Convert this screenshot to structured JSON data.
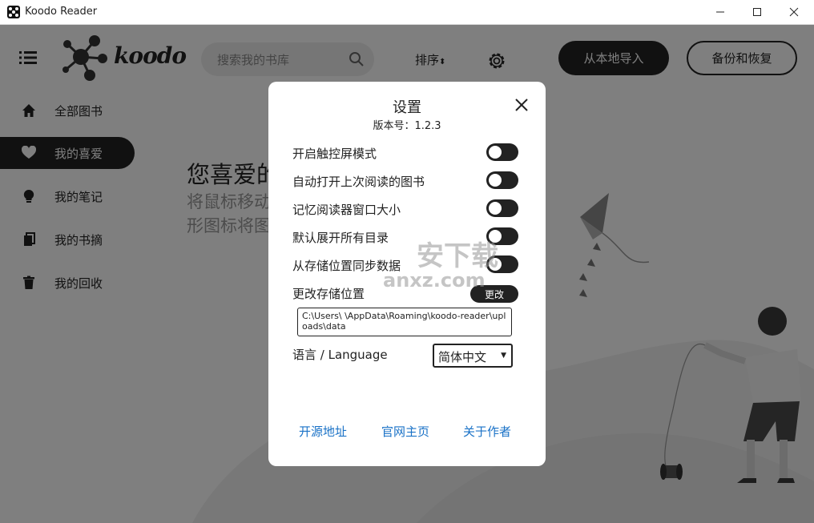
{
  "window": {
    "title": "Koodo Reader",
    "controls": [
      "minimize",
      "maximize",
      "close"
    ]
  },
  "header": {
    "logo_text": "koodo",
    "search_placeholder": "搜索我的书库",
    "sort_label": "排序",
    "import_button": "从本地导入",
    "backup_button": "备份和恢复"
  },
  "sidebar": {
    "items": [
      {
        "label": "全部图书",
        "icon": "home-icon",
        "active": false
      },
      {
        "label": "我的喜爱",
        "icon": "heart-icon",
        "active": true
      },
      {
        "label": "我的笔记",
        "icon": "lightbulb-icon",
        "active": false
      },
      {
        "label": "我的书摘",
        "icon": "bookmark-copy-icon",
        "active": false
      },
      {
        "label": "我的回收",
        "icon": "trash-icon",
        "active": false
      }
    ]
  },
  "main": {
    "empty_title": "您喜爱的",
    "empty_desc_line1": "将鼠标移动",
    "empty_desc_line2": "形图标将图"
  },
  "settings": {
    "title": "设置",
    "version": "版本号：1.2.3",
    "options": [
      {
        "label": "开启触控屏模式",
        "enabled": false
      },
      {
        "label": "自动打开上次阅读的图书",
        "enabled": false
      },
      {
        "label": "记忆阅读器窗口大小",
        "enabled": false
      },
      {
        "label": "默认展开所有目录",
        "enabled": false
      },
      {
        "label": "从存储位置同步数据",
        "enabled": false
      }
    ],
    "storage_label": "更改存储位置",
    "change_button": "更改",
    "storage_path": "C:\\Users\\            \\AppData\\Roaming\\koodo-reader\\uploads\\data",
    "language_label": "语言 / Language",
    "language_value": "简体中文",
    "links": [
      "开源地址",
      "官网主页",
      "关于作者"
    ]
  },
  "watermark": {
    "text": "安下载",
    "domain": "anxz.com"
  },
  "colors": {
    "accent_dark": "#222222",
    "link": "#1a72c7",
    "overlay": "rgba(0,0,0,0.5)"
  }
}
